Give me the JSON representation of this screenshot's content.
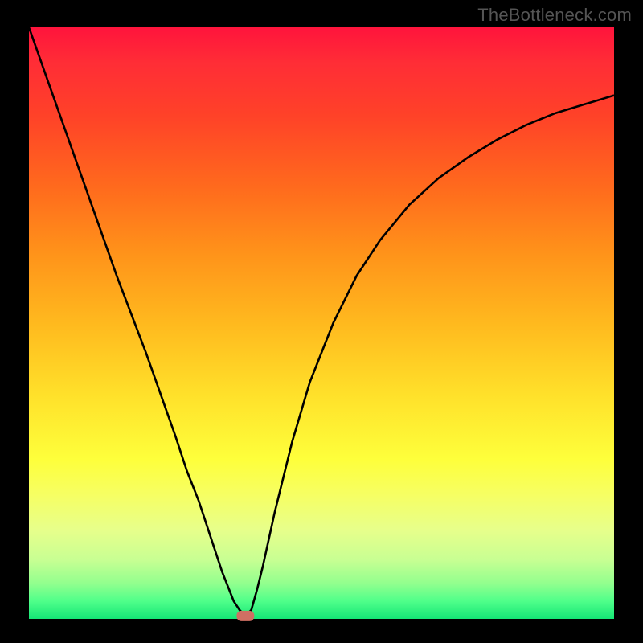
{
  "watermark": "TheBottleneck.com",
  "chart_data": {
    "type": "line",
    "title": "",
    "xlabel": "",
    "ylabel": "",
    "xlim": [
      0,
      100
    ],
    "ylim": [
      0,
      100
    ],
    "x": [
      0,
      5,
      10,
      15,
      20,
      25,
      27,
      29,
      31,
      33,
      35,
      36,
      37,
      38,
      39,
      40,
      42,
      45,
      48,
      52,
      56,
      60,
      65,
      70,
      75,
      80,
      85,
      90,
      95,
      100
    ],
    "values": [
      100,
      86,
      72,
      58,
      45,
      31,
      25,
      20,
      14,
      8,
      3,
      1.5,
      0.5,
      1.5,
      5,
      9,
      18,
      30,
      40,
      50,
      58,
      64,
      70,
      74.5,
      78,
      81,
      83.5,
      85.5,
      87,
      88.5
    ],
    "marker": {
      "x": 37,
      "y": 0.5
    },
    "gradient_bands": [
      {
        "color": "#ff143c",
        "pos": 0.0
      },
      {
        "color": "#ff2d36",
        "pos": 0.06
      },
      {
        "color": "#ff4228",
        "pos": 0.15
      },
      {
        "color": "#ff6a1d",
        "pos": 0.27
      },
      {
        "color": "#ff921a",
        "pos": 0.38
      },
      {
        "color": "#ffb91e",
        "pos": 0.5
      },
      {
        "color": "#ffe02a",
        "pos": 0.62
      },
      {
        "color": "#feff3b",
        "pos": 0.73
      },
      {
        "color": "#f6ff63",
        "pos": 0.79
      },
      {
        "color": "#e7ff8b",
        "pos": 0.85
      },
      {
        "color": "#c8ff93",
        "pos": 0.9
      },
      {
        "color": "#92ff8e",
        "pos": 0.94
      },
      {
        "color": "#4fff8a",
        "pos": 0.97
      },
      {
        "color": "#15e676",
        "pos": 1.0
      }
    ]
  }
}
